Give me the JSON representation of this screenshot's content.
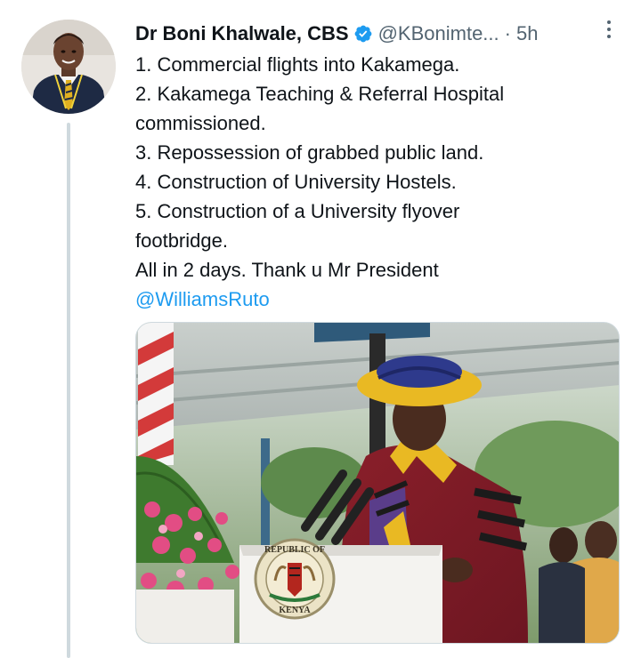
{
  "author": {
    "display_name": "Dr Boni Khalwale, CBS",
    "handle": "@KBonimte...",
    "separator": "·",
    "time": "5h",
    "verified": true,
    "avatar_icon": "profile-photo"
  },
  "tweet": {
    "lines": [
      "1. Commercial flights into Kakamega.",
      "2. Kakamega Teaching & Referral Hospital",
      "commissioned.",
      "3. Repossession of grabbed public land.",
      "4. Construction of University Hostels.",
      "5. Construction of a University flyover",
      "footbridge.",
      "All in 2 days. Thank u Mr President"
    ],
    "mention": "@WilliamsRuto"
  },
  "media": {
    "seal_top_text": "REPUBLIC OF",
    "seal_bottom_text": "KENYA"
  },
  "colors": {
    "link": "#1d9bf0",
    "verified_badge": "#1d9bf0",
    "secondary_text": "#536471",
    "thread_line": "#cfd9de"
  }
}
